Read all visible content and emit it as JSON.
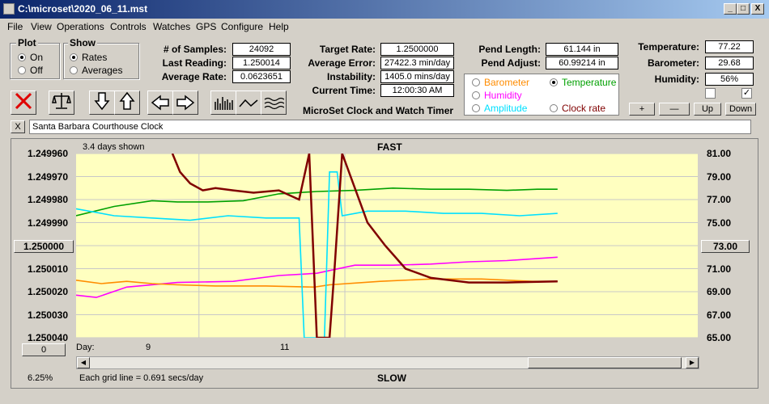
{
  "window": {
    "title": "C:\\microset\\2020_06_11.mst",
    "min": "_",
    "max": "□",
    "close": "X"
  },
  "menu": [
    "File",
    "View",
    "Operations",
    "Controls",
    "Watches",
    "GPS",
    "Configure",
    "Help"
  ],
  "plot_group": {
    "title": "Plot",
    "options": [
      "On",
      "Off"
    ],
    "selected": "On"
  },
  "show_group": {
    "title": "Show",
    "options": [
      "Rates",
      "Averages"
    ],
    "selected": "Rates"
  },
  "stats": {
    "samples_label": "# of Samples:",
    "samples": "24092",
    "last_label": "Last Reading:",
    "last": "1.250014",
    "avg_label": "Average Rate:",
    "avg": "0.0623651",
    "target_label": "Target Rate:",
    "target": "1.2500000",
    "avgerr_label": "Average Error:",
    "avgerr": "27422.3 min/day",
    "instab_label": "Instability:",
    "instab": "1405.0 mins/day",
    "time_label": "Current Time:",
    "time": "12:00:30 AM",
    "pendlen_label": "Pend Length:",
    "pendlen": "61.144 in",
    "pendadj_label": "Pend Adjust:",
    "pendadj": "60.99214 in",
    "temp_label": "Temperature:",
    "temp": "77.22",
    "baro_label": "Barometer:",
    "baro": "29.68",
    "hum_label": "Humidity:",
    "hum": "56%"
  },
  "app_title": "MicroSet Clock and Watch Timer",
  "sensors": {
    "barometer": "Barometer",
    "temperature": "Temperature",
    "humidity": "Humidity",
    "amplitude": "Amplitude",
    "clockrate": "Clock rate",
    "selected": "Temperature"
  },
  "colors": {
    "barometer": "#ff8c00",
    "temperature": "#00a000",
    "humidity": "#ff00ff",
    "amplitude": "#00e0ff",
    "clockrate": "#800000",
    "plot_bg": "#ffffc0"
  },
  "adj_buttons": {
    "plus": "+",
    "minus": "—",
    "up": "Up",
    "down": "Down"
  },
  "checkboxes": [
    false,
    true
  ],
  "name_close": "X",
  "clock_name": "Santa Barbara Courthouse Clock",
  "graph": {
    "days_shown": "3.4 days shown",
    "fast": "FAST",
    "slow": "SLOW",
    "day_label": "Day:",
    "day_ticks": [
      "9",
      "11"
    ],
    "grid_note": "Each grid line = 0.691 secs/day",
    "left_button": "1.250000",
    "right_button": "73.00",
    "zero_button": "0",
    "percent": "6.25%"
  },
  "chart_data": {
    "type": "line",
    "y_left_ticks": [
      "1.249960",
      "1.249970",
      "1.249980",
      "1.249990",
      "1.250000",
      "1.250010",
      "1.250020",
      "1.250030",
      "1.250040"
    ],
    "y_right_ticks": [
      "81.00",
      "79.00",
      "77.00",
      "75.00",
      "73.00",
      "71.00",
      "69.00",
      "67.00",
      "65.00"
    ],
    "ylim_left": [
      1.24996,
      1.25004
    ],
    "ylim_right": [
      65,
      81
    ],
    "series": [
      {
        "name": "Temperature",
        "color": "#00a000",
        "points": [
          [
            0.0,
            75.6
          ],
          [
            0.15,
            76.4
          ],
          [
            0.3,
            76.9
          ],
          [
            0.4,
            76.8
          ],
          [
            0.52,
            76.8
          ],
          [
            0.66,
            76.9
          ],
          [
            0.8,
            77.5
          ],
          [
            0.95,
            77.7
          ],
          [
            1.1,
            77.8
          ],
          [
            1.25,
            78.0
          ],
          [
            1.4,
            77.9
          ],
          [
            1.55,
            77.9
          ],
          [
            1.7,
            77.8
          ],
          [
            1.82,
            77.9
          ],
          [
            1.9,
            77.9
          ]
        ]
      },
      {
        "name": "Humidity",
        "color": "#ff00ff",
        "points": [
          [
            0.0,
            68.7
          ],
          [
            0.08,
            68.5
          ],
          [
            0.2,
            69.4
          ],
          [
            0.4,
            69.8
          ],
          [
            0.62,
            69.9
          ],
          [
            0.8,
            70.4
          ],
          [
            0.95,
            70.6
          ],
          [
            1.1,
            71.3
          ],
          [
            1.25,
            71.3
          ],
          [
            1.4,
            71.4
          ],
          [
            1.55,
            71.6
          ],
          [
            1.7,
            71.7
          ],
          [
            1.9,
            72.0
          ]
        ]
      },
      {
        "name": "Barometer",
        "color": "#ff8c00",
        "points": [
          [
            0.0,
            70.0
          ],
          [
            0.1,
            69.7
          ],
          [
            0.2,
            69.9
          ],
          [
            0.3,
            69.7
          ],
          [
            0.4,
            69.6
          ],
          [
            0.55,
            69.5
          ],
          [
            0.75,
            69.5
          ],
          [
            0.94,
            69.4
          ],
          [
            1.0,
            69.6
          ],
          [
            1.2,
            69.9
          ],
          [
            1.4,
            70.1
          ],
          [
            1.6,
            70.1
          ],
          [
            1.8,
            69.9
          ],
          [
            1.9,
            69.9
          ]
        ]
      },
      {
        "name": "Amplitude",
        "color": "#00e0ff",
        "points": [
          [
            0.0,
            76.2
          ],
          [
            0.15,
            75.6
          ],
          [
            0.3,
            75.4
          ],
          [
            0.45,
            75.2
          ],
          [
            0.6,
            75.6
          ],
          [
            0.75,
            75.4
          ],
          [
            0.88,
            75.4
          ],
          [
            0.9,
            65.0
          ],
          [
            0.98,
            65.0
          ],
          [
            1.0,
            79.4
          ],
          [
            1.03,
            79.4
          ],
          [
            1.05,
            75.6
          ],
          [
            1.15,
            76.0
          ],
          [
            1.3,
            76.0
          ],
          [
            1.45,
            75.8
          ],
          [
            1.6,
            75.8
          ],
          [
            1.75,
            75.6
          ],
          [
            1.9,
            75.8
          ]
        ]
      },
      {
        "name": "Clock rate",
        "color": "#800000",
        "points": [
          [
            0.38,
            81.0
          ],
          [
            0.41,
            79.4
          ],
          [
            0.45,
            78.4
          ],
          [
            0.5,
            77.8
          ],
          [
            0.55,
            78.0
          ],
          [
            0.62,
            77.8
          ],
          [
            0.7,
            77.6
          ],
          [
            0.8,
            77.8
          ],
          [
            0.88,
            77.0
          ],
          [
            0.92,
            81.0
          ],
          [
            0.95,
            65.0
          ],
          [
            1.0,
            65.0
          ],
          [
            1.02,
            71.0
          ],
          [
            1.05,
            81.0
          ],
          [
            1.1,
            78.0
          ],
          [
            1.15,
            75.0
          ],
          [
            1.22,
            73.0
          ],
          [
            1.3,
            71.0
          ],
          [
            1.4,
            70.2
          ],
          [
            1.55,
            69.8
          ],
          [
            1.7,
            69.8
          ],
          [
            1.9,
            69.9
          ]
        ]
      }
    ]
  }
}
